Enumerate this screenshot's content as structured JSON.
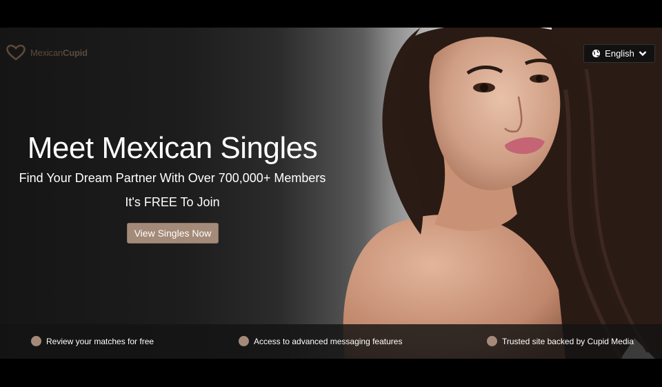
{
  "brand": {
    "name_part1": "Mexican",
    "name_part2": "Cupid"
  },
  "language": {
    "label": "English"
  },
  "hero": {
    "headline": "Meet Mexican Singles",
    "subheadline": "Find Your Dream Partner With Over 700,000+ Members",
    "tagline": "It's FREE To Join",
    "cta_label": "View Singles Now"
  },
  "features": [
    {
      "label": "Review your matches for free"
    },
    {
      "label": "Access to advanced messaging features"
    },
    {
      "label": "Trusted site backed by Cupid Media"
    }
  ],
  "colors": {
    "accent": "#a48a78",
    "logo": "#5c4a3c",
    "background_dark": "#151515"
  },
  "icons": {
    "logo": "heart-outline-icon",
    "language": "globe-icon",
    "dropdown": "chevron-down-icon",
    "feature_bullet": "circle-bullet-icon"
  }
}
